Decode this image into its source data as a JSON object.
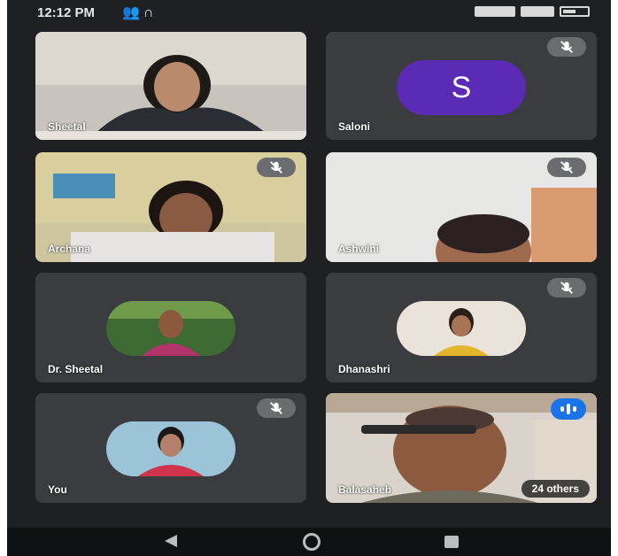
{
  "status_bar": {
    "time": "12:12 PM",
    "icons": [
      "people-icon",
      "headset-icon"
    ]
  },
  "participants": [
    {
      "name": "Sheetal",
      "type": "video",
      "muted": false
    },
    {
      "name": "Saloni",
      "type": "letter",
      "initial": "S",
      "muted": true
    },
    {
      "name": "Archana",
      "type": "video",
      "muted": true
    },
    {
      "name": "Ashwini",
      "type": "video",
      "muted": true
    },
    {
      "name": "Dr. Sheetal",
      "type": "photo",
      "muted": false
    },
    {
      "name": "Dhanashri",
      "type": "photo",
      "muted": true
    },
    {
      "name": "You",
      "type": "photo",
      "muted": true
    },
    {
      "name": "Balasaheb",
      "type": "video",
      "speaking": true
    }
  ],
  "others_chip": "24 others",
  "colors": {
    "background": "#1f2023",
    "tile": "#3b3c3f",
    "avatar_letter": "#5b2bb5",
    "speaking": "#1a73e8"
  }
}
